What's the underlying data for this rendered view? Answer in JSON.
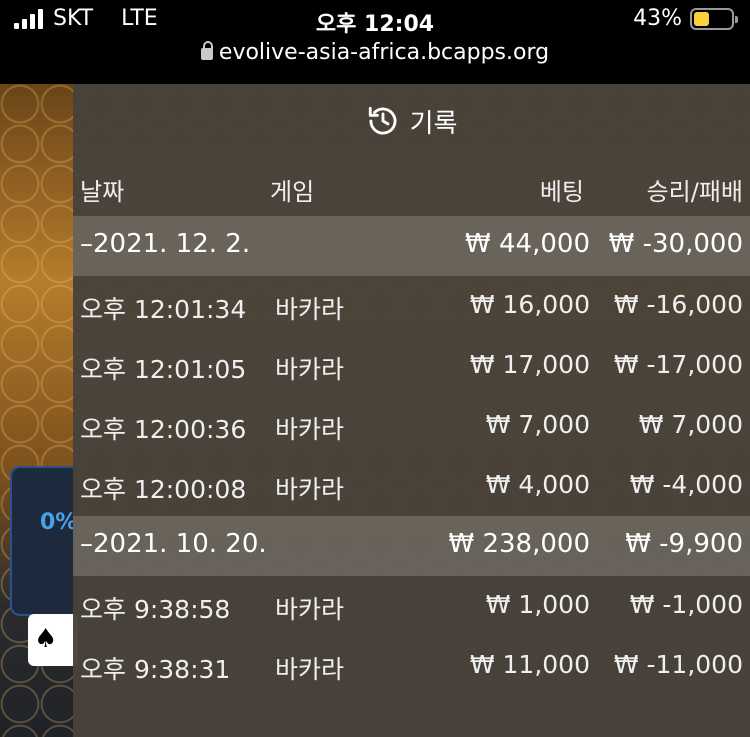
{
  "status_bar": {
    "carrier": "SKT",
    "network": "LTE",
    "time": "오후 12:04",
    "battery_percent": "43%",
    "battery_level": 0.43,
    "battery_color": "#f7d23c"
  },
  "browser": {
    "url": "evolive-asia-africa.bcapps.org"
  },
  "background": {
    "percent_label": "0%",
    "card_icon": "spade-icon"
  },
  "history": {
    "title": "기록",
    "icon": "history-icon",
    "columns": {
      "date": "날짜",
      "game": "게임",
      "bet": "베팅",
      "win_loss": "승리/패배"
    },
    "groups": [
      {
        "date": "–2021. 12. 2.",
        "bet": "₩ 44,000",
        "win_loss": "₩ -30,000",
        "rows": [
          {
            "time": "오후 12:01:34",
            "game": "바카라",
            "bet": "₩ 16,000",
            "win_loss": "₩ -16,000"
          },
          {
            "time": "오후 12:01:05",
            "game": "바카라",
            "bet": "₩ 17,000",
            "win_loss": "₩ -17,000"
          },
          {
            "time": "오후 12:00:36",
            "game": "바카라",
            "bet": "₩ 7,000",
            "win_loss": "₩ 7,000"
          },
          {
            "time": "오후 12:00:08",
            "game": "바카라",
            "bet": "₩ 4,000",
            "win_loss": "₩ -4,000"
          }
        ]
      },
      {
        "date": "–2021. 10. 20.",
        "bet": "₩ 238,000",
        "win_loss": "₩ -9,900",
        "rows": [
          {
            "time": "오후 9:38:58",
            "game": "바카라",
            "bet": "₩ 1,000",
            "win_loss": "₩ -1,000"
          },
          {
            "time": "오후 9:38:31",
            "game": "바카라",
            "bet": "₩ 11,000",
            "win_loss": "₩ -11,000"
          }
        ]
      }
    ]
  }
}
